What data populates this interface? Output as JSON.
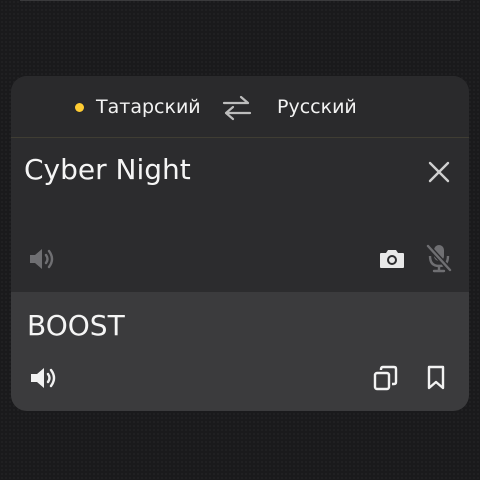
{
  "languages": {
    "source": "Татарский",
    "target": "Русский",
    "source_indicator_color": "#ffcc33"
  },
  "input": {
    "text": "Cyber Night"
  },
  "output": {
    "text": "BOOST"
  },
  "icons": {
    "swap": "swap-arrows-icon",
    "close": "close-icon",
    "source_speaker": "speaker-icon",
    "camera": "camera-icon",
    "microphone": "microphone-off-icon",
    "result_speaker": "speaker-icon",
    "copy": "copy-icon",
    "bookmark": "bookmark-icon"
  }
}
